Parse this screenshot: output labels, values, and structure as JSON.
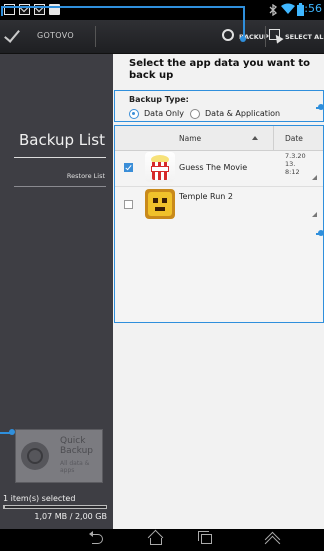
{
  "status_bar": {
    "time": "9:56",
    "icons": [
      "image-icon",
      "mail-icon",
      "mail-icon",
      "store-icon",
      "bluetooth-icon",
      "wifi-icon",
      "battery-icon"
    ]
  },
  "action_bar": {
    "done_label": "GOTOVO",
    "backup_label": "BACKUP",
    "select_all_label": "SELECT ALL"
  },
  "left_panel": {
    "title": "Backup List",
    "subtitle": "Restore List",
    "quick_backup": {
      "title_line1": "Quick",
      "title_line2": "Backup",
      "sub_line1": "All data &",
      "sub_line2": "apps"
    },
    "selection_text": "1 item(s) selected",
    "storage_text": "1,07 MB / 2,00 GB",
    "storage_used_fraction": 0.0005
  },
  "main": {
    "prompt": "Select the app data you want to back up",
    "backup_type": {
      "label": "Backup Type:",
      "options": [
        "Data Only",
        "Data & Application"
      ],
      "selected": "Data Only"
    },
    "list": {
      "columns": [
        "Name",
        "Date"
      ],
      "rows": [
        {
          "name": "Guess The Movie",
          "date_line1": "7.3.20",
          "date_line2": "13.",
          "date_line3": "8:12",
          "checked": true,
          "icon": "popcorn-icon"
        },
        {
          "name": "Temple Run 2",
          "date_line1": "",
          "date_line2": "",
          "date_line3": "",
          "checked": false,
          "icon": "temple-run-icon"
        }
      ]
    }
  },
  "accent_color": "#2f8fdc"
}
